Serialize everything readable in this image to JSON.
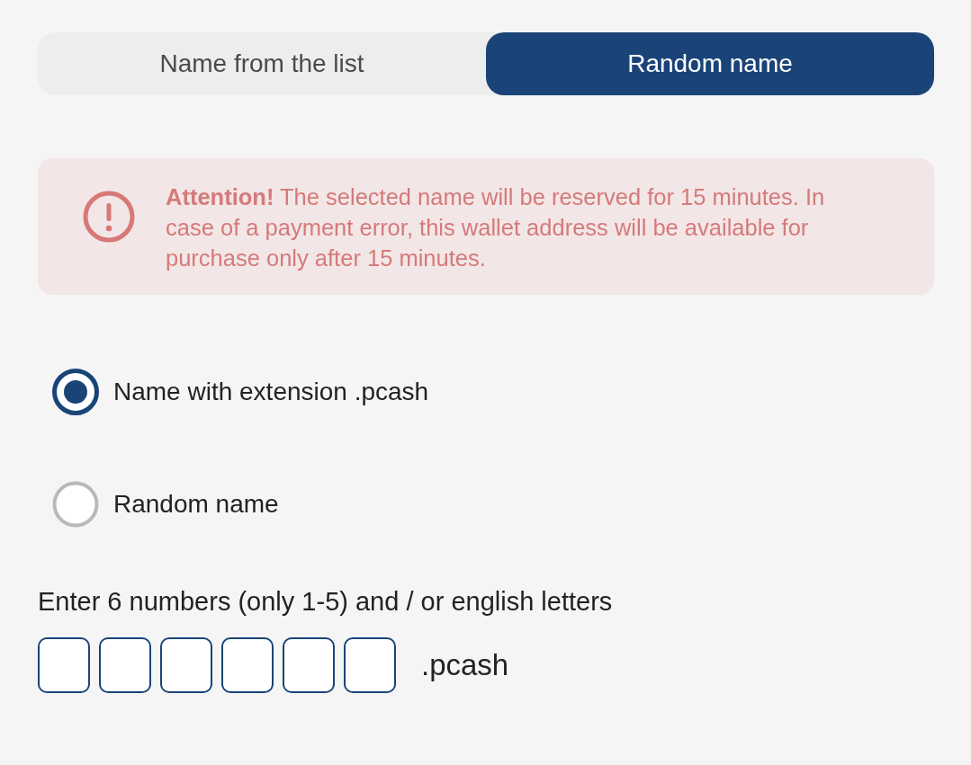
{
  "tabs": [
    {
      "label": "Name from the list",
      "selected": false
    },
    {
      "label": "Random name",
      "selected": true
    }
  ],
  "alert": {
    "text": "**Attention!** The selected name will be reserved for 15 minutes. In case of a payment error, this wallet address will be available for purchase only after 15 minutes."
  },
  "options": [
    {
      "label": "Name with extension .pcash",
      "selected": true
    },
    {
      "label": "Random name",
      "selected": false
    }
  ],
  "code_input": {
    "label": "Enter 6 numbers (only 1-5) and / or english letters",
    "cells": [
      {
        "kind": "char-box"
      },
      {
        "kind": "char-box"
      },
      {
        "kind": "char-box"
      },
      {
        "kind": "char-box"
      },
      {
        "kind": "char-box"
      },
      {
        "kind": "char-box"
      }
    ],
    "suffix": ".pcash"
  }
}
